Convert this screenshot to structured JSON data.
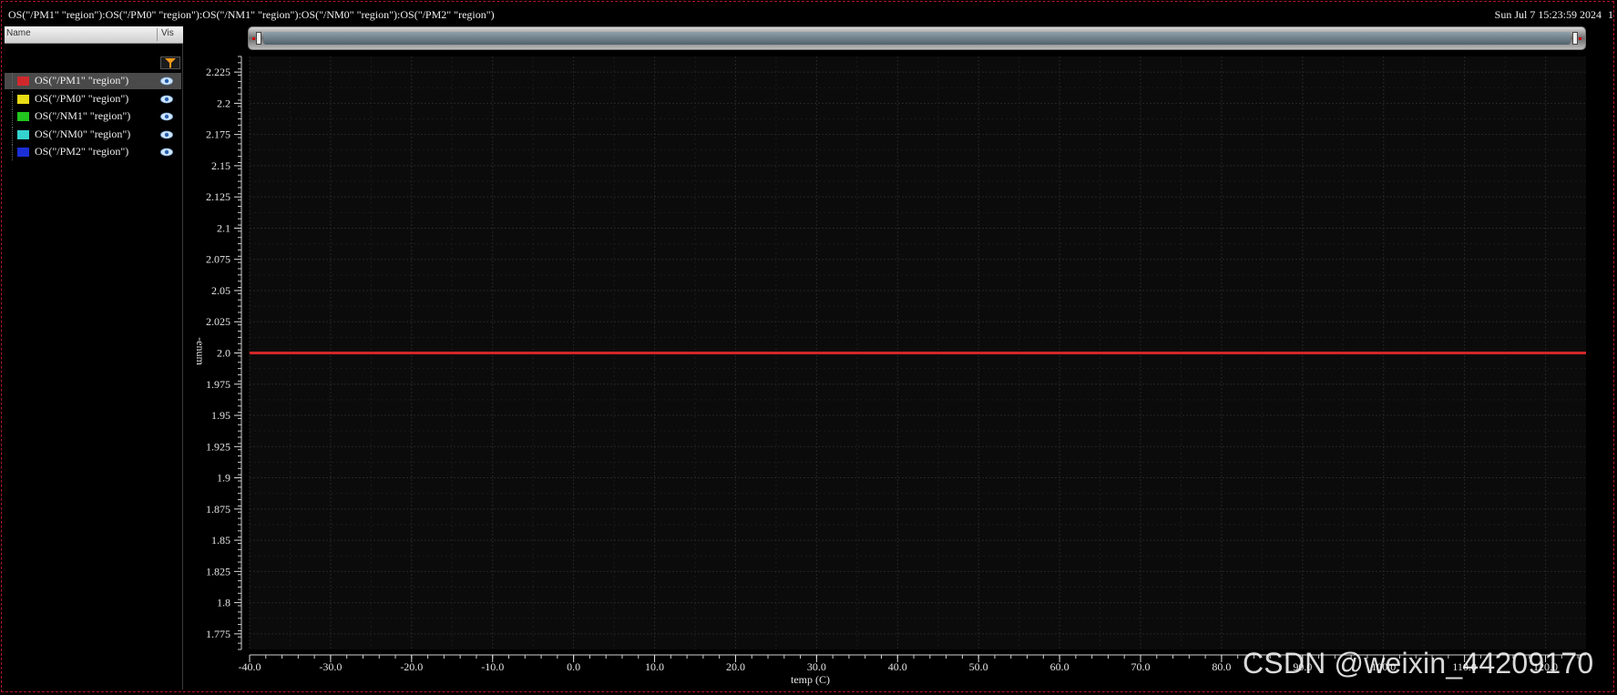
{
  "window": {
    "expression_title": "OS(\"/PM1\" \"region\"):OS(\"/PM0\" \"region\"):OS(\"/NM1\" \"region\"):OS(\"/NM0\" \"region\"):OS(\"/PM2\" \"region\")",
    "timestamp": "Sun Jul 7 15:23:59 2024",
    "timestamp_suffix": "1"
  },
  "legend": {
    "header_name": "Name",
    "header_vis": "Vis",
    "items": [
      {
        "label": "OS(\"/PM1\" \"region\")",
        "color": "#d0282a",
        "selected": true
      },
      {
        "label": "OS(\"/PM0\" \"region\")",
        "color": "#e8dc15",
        "selected": false
      },
      {
        "label": "OS(\"/NM1\" \"region\")",
        "color": "#22c51f",
        "selected": false
      },
      {
        "label": "OS(\"/NM0\" \"region\")",
        "color": "#35d3d0",
        "selected": false
      },
      {
        "label": "OS(\"/PM2\" \"region\")",
        "color": "#1a2fd6",
        "selected": false
      }
    ]
  },
  "chart_data": {
    "type": "line",
    "xlabel": "temp (C)",
    "ylabel": "-enum",
    "xlim": [
      -40,
      125
    ],
    "ylim": [
      1.7625,
      2.2375
    ],
    "x_ticks": [
      -40,
      -30,
      -20,
      -10,
      0,
      10,
      20,
      30,
      40,
      50,
      60,
      70,
      80,
      90,
      100,
      110,
      120
    ],
    "x_tick_labels": [
      "-40.0",
      "-30.0",
      "-20.0",
      "-10.0",
      "0.0",
      "10.0",
      "20.0",
      "30.0",
      "40.0",
      "50.0",
      "60.0",
      "70.0",
      "80.0",
      "90.0",
      "100.0",
      "110.0",
      "120.0"
    ],
    "y_ticks": [
      1.775,
      1.8,
      1.825,
      1.85,
      1.875,
      1.9,
      1.925,
      1.95,
      1.975,
      2.0,
      2.025,
      2.05,
      2.075,
      2.1,
      2.125,
      2.15,
      2.175,
      2.2,
      2.225
    ],
    "y_tick_labels": [
      "1.775",
      "1.8",
      "1.825",
      "1.85",
      "1.875",
      "1.9",
      "1.925",
      "1.95",
      "1.975",
      "2.0",
      "2.025",
      "2.05",
      "2.075",
      "2.1",
      "2.125",
      "2.15",
      "2.175",
      "2.2",
      "2.225"
    ],
    "grid": true,
    "series": [
      {
        "name": "OS(\"/PM1\" \"region\")",
        "color": "#d0282a",
        "x": [
          -40,
          125
        ],
        "y": [
          2.0,
          2.0
        ]
      }
    ]
  },
  "watermark": "CSDN @weixin_44209170"
}
